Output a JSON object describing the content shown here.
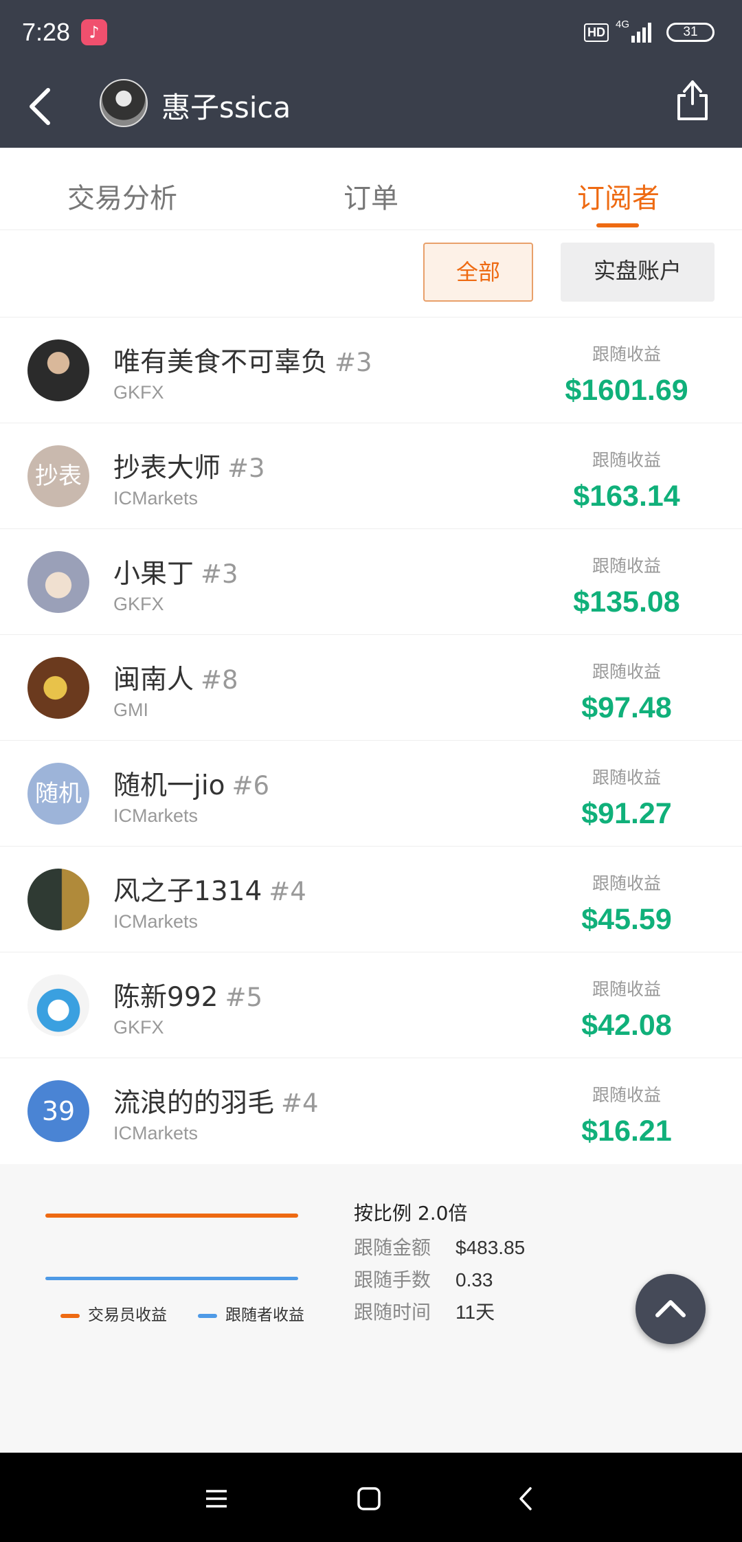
{
  "status_bar": {
    "time": "7:28",
    "hd": "HD",
    "network": "4G",
    "battery": "31"
  },
  "header": {
    "title": "惠子ssica"
  },
  "tabs": [
    {
      "label": "交易分析",
      "active": false
    },
    {
      "label": "订单",
      "active": false
    },
    {
      "label": "订阅者",
      "active": true
    }
  ],
  "filters": {
    "all": "全部",
    "real": "实盘账户"
  },
  "profit_label": "跟随收益",
  "subscribers": [
    {
      "name": "唯有美食不可辜负",
      "rank": "#3",
      "broker": "GKFX",
      "profit": "$1601.69",
      "avatar_text": "",
      "avatar_color": "#4a4a4a"
    },
    {
      "name": "抄表大师",
      "rank": "#3",
      "broker": "ICMarkets",
      "profit": "$163.14",
      "avatar_text": "抄表",
      "avatar_color": "#c9b9ae"
    },
    {
      "name": "小果丁",
      "rank": "#3",
      "broker": "GKFX",
      "profit": "$135.08",
      "avatar_text": "",
      "avatar_color": "#8a8fa8"
    },
    {
      "name": "闽南人",
      "rank": "#8",
      "broker": "GMI",
      "profit": "$97.48",
      "avatar_text": "",
      "avatar_color": "#7a4a2a"
    },
    {
      "name": "随机一jio",
      "rank": "#6",
      "broker": "ICMarkets",
      "profit": "$91.27",
      "avatar_text": "随机",
      "avatar_color": "#9db4d9"
    },
    {
      "name": "风之子1314",
      "rank": "#4",
      "broker": "ICMarkets",
      "profit": "$45.59",
      "avatar_text": "",
      "avatar_color": "#3d4a3e"
    },
    {
      "name": "陈新992",
      "rank": "#5",
      "broker": "GKFX",
      "profit": "$42.08",
      "avatar_text": "",
      "avatar_color": "#f2f2f2"
    },
    {
      "name": "流浪的的羽毛",
      "rank": "#4",
      "broker": "ICMarkets",
      "profit": "$16.21",
      "avatar_text": "39",
      "avatar_color": "#4a84d4"
    }
  ],
  "panel": {
    "legend_trader": "交易员收益",
    "legend_follower": "跟随者收益",
    "ratio": "按比例 2.0倍",
    "stats": [
      {
        "label": "跟随金额",
        "value": "$483.85"
      },
      {
        "label": "跟随手数",
        "value": "0.33"
      },
      {
        "label": "跟随时间",
        "value": "11天"
      }
    ]
  },
  "colors": {
    "accent": "#ee6a12",
    "profit": "#10b07a",
    "header_bg": "#3a3f4b",
    "follower_line": "#4e9ae6"
  }
}
